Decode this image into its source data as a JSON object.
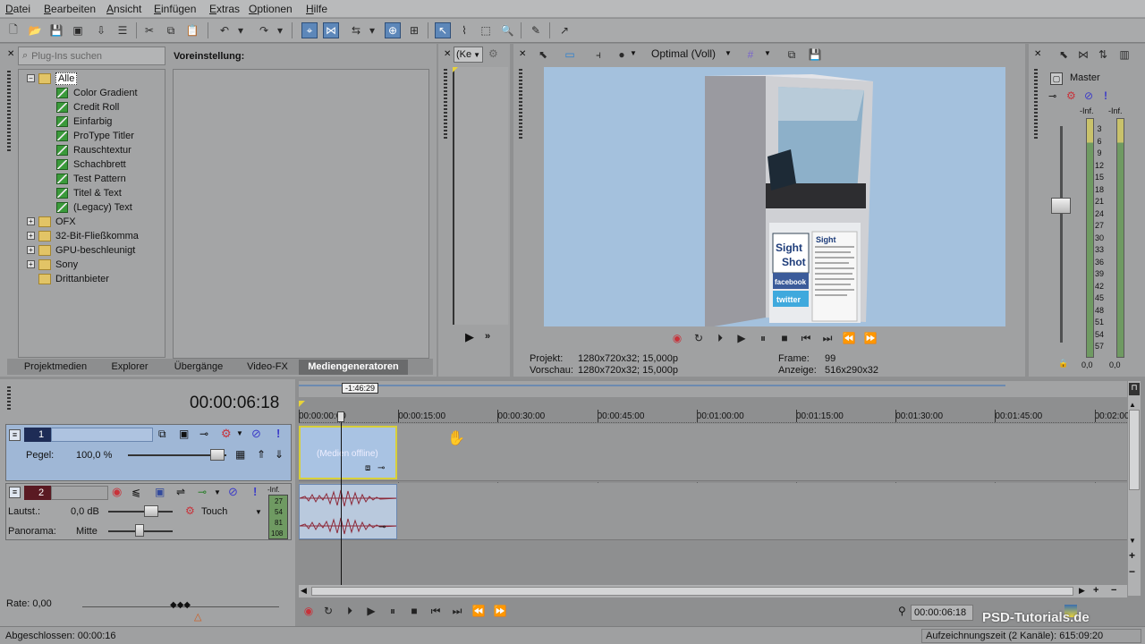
{
  "menu": [
    "Datei",
    "Bearbeiten",
    "Ansicht",
    "Einfügen",
    "Extras",
    "Optionen",
    "Hilfe"
  ],
  "plugins": {
    "search_placeholder": "Plug-Ins suchen",
    "preset_label": "Voreinstellung:",
    "tree": {
      "root": "Alle",
      "children": [
        "Color Gradient",
        "Credit Roll",
        "Einfarbig",
        "ProType Titler",
        "Rauschtextur",
        "Schachbrett",
        "Test Pattern",
        "Titel & Text",
        "(Legacy) Text"
      ],
      "groups": [
        "OFX",
        "32-Bit-Fließkomma",
        "GPU-beschleunigt",
        "Sony",
        "Drittanbieter"
      ]
    },
    "tabs": [
      "Projektmedien",
      "Explorer",
      "Übergänge",
      "Video-FX",
      "Mediengeneratoren"
    ],
    "active_tab": "Mediengeneratoren"
  },
  "trimmer": {
    "dropdown_value": "(Ke"
  },
  "preview": {
    "quality": "Optimal (Voll)",
    "projekt_label": "Projekt:",
    "projekt_value": "1280x720x32; 15,000p",
    "vorschau_label": "Vorschau:",
    "vorschau_value": "1280x720x32; 15,000p",
    "frame_label": "Frame:",
    "frame_value": "99",
    "anzeige_label": "Anzeige:",
    "anzeige_value": "516x290x32",
    "sign_text": [
      "Sight",
      "Shot",
      "facebook",
      "twitter"
    ]
  },
  "master": {
    "title": "Master",
    "inf_left": "-Inf.",
    "inf_right": "-Inf.",
    "scale": [
      "3",
      "6",
      "9",
      "12",
      "15",
      "18",
      "21",
      "24",
      "27",
      "30",
      "33",
      "36",
      "39",
      "42",
      "45",
      "48",
      "51",
      "54",
      "57"
    ],
    "val_left": "0,0",
    "val_right": "0,0"
  },
  "timeline": {
    "timecode": "00:00:06:18",
    "region_length": "-1:46:29",
    "ruler": [
      "00:00:00:00",
      "00:00:15:00",
      "00:00:30:00",
      "00:00:45:00",
      "00:01:00:00",
      "00:01:15:00",
      "00:01:30:00",
      "00:01:45:00",
      "00:02:00"
    ],
    "video_track": {
      "number": "1",
      "pegel_label": "Pegel:",
      "pegel_value": "100,0 %"
    },
    "audio_track": {
      "number": "2",
      "laut_label": "Lautst.:",
      "laut_value": "0,0 dB",
      "pan_label": "Panorama:",
      "pan_value": "Mitte",
      "automation": "Touch",
      "meter_values": [
        "-Inf.",
        "27",
        "54",
        "81",
        "108"
      ]
    },
    "video_event_label": "(Medien offline)",
    "rate_label": "Rate: 0,00",
    "end_timecode": "00:00:06:18"
  },
  "status": {
    "left": "Abgeschlossen: 00:00:16",
    "right": "Aufzeichnungszeit (2 Kanäle): 615:09:20"
  },
  "watermark": "PSD-Tutorials.de",
  "colors": {
    "accent": "#5d87b9",
    "selected_track": "#9fb7d6",
    "video_event": "#a9c3e3",
    "audio_wave": "#8d2a3a"
  }
}
